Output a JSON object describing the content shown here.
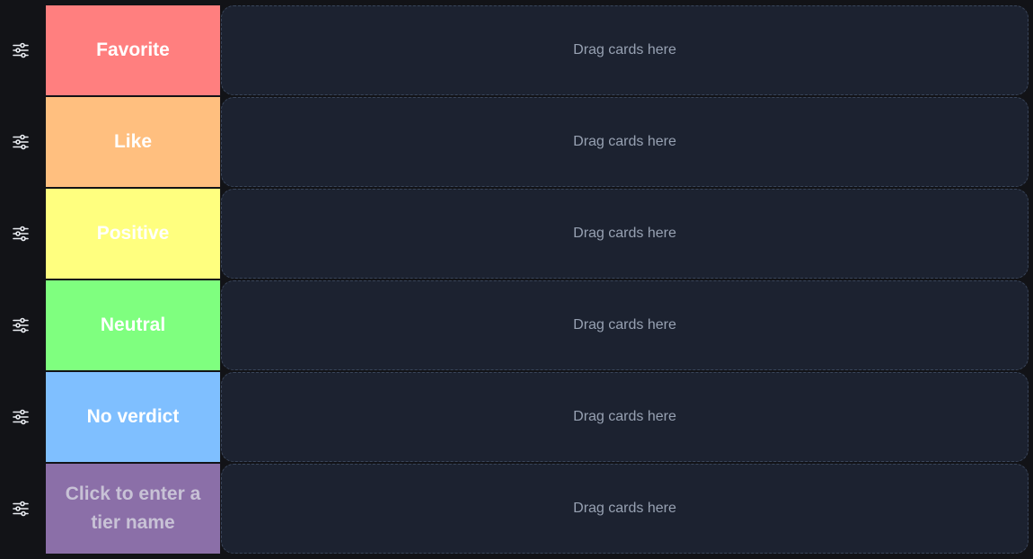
{
  "dropzone_placeholder": "Drag cards here",
  "tiers": [
    {
      "label": "Favorite",
      "color": "#ff7f7f"
    },
    {
      "label": "Like",
      "color": "#ffbf7f"
    },
    {
      "label": "Positive",
      "color": "#ffff7f"
    },
    {
      "label": "Neutral",
      "color": "#7fff7f"
    },
    {
      "label": "No verdict",
      "color": "#7fbfff"
    },
    {
      "label": "Click to enter a tier name",
      "color": "#8b6fa8",
      "is_placeholder": true
    }
  ],
  "icons": {
    "settings": "sliders-icon"
  }
}
